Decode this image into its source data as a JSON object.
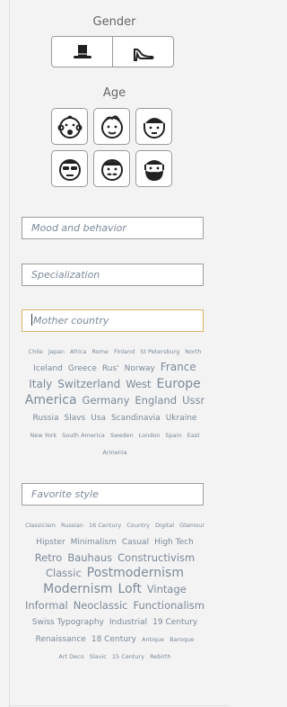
{
  "gender": {
    "label": "Gender",
    "options": [
      {
        "name": "male",
        "icon": "top-hat-icon"
      },
      {
        "name": "female",
        "icon": "high-heel-icon"
      }
    ]
  },
  "age": {
    "label": "Age",
    "options": [
      {
        "icon": "baby-face-icon"
      },
      {
        "icon": "child-face-icon"
      },
      {
        "icon": "teen-cap-face-icon"
      },
      {
        "icon": "sunglasses-face-icon"
      },
      {
        "icon": "mustache-face-icon"
      },
      {
        "icon": "bearded-face-icon"
      }
    ]
  },
  "mood": {
    "placeholder": "Mood and behavior"
  },
  "specialization": {
    "placeholder": "Specialization"
  },
  "mother_country": {
    "placeholder": "Mother country",
    "tags": [
      {
        "text": "Chile",
        "size": 6.5
      },
      {
        "text": "Japan",
        "size": 6.5
      },
      {
        "text": "Africa",
        "size": 6.5
      },
      {
        "text": "Rome",
        "size": 6.5
      },
      {
        "text": "Finland",
        "size": 6.5
      },
      {
        "text": "St Petersburg",
        "size": 6.5
      },
      {
        "text": "North",
        "size": 6.5
      },
      {
        "text": "Iceland",
        "size": 9
      },
      {
        "text": "Greece",
        "size": 9
      },
      {
        "text": "Rus'",
        "size": 9
      },
      {
        "text": "Norway",
        "size": 9
      },
      {
        "text": "France",
        "size": 12
      },
      {
        "text": "Italy",
        "size": 12
      },
      {
        "text": "Switzerland",
        "size": 12
      },
      {
        "text": "West",
        "size": 11.5
      },
      {
        "text": "Europe",
        "size": 14
      },
      {
        "text": "America",
        "size": 14
      },
      {
        "text": "Germany",
        "size": 11.5
      },
      {
        "text": "England",
        "size": 11.5
      },
      {
        "text": "Ussr",
        "size": 11.5
      },
      {
        "text": "Russia",
        "size": 9
      },
      {
        "text": "Slavs",
        "size": 9
      },
      {
        "text": "Usa",
        "size": 9
      },
      {
        "text": "Scandinavia",
        "size": 9
      },
      {
        "text": "Ukraine",
        "size": 9
      },
      {
        "text": "New York",
        "size": 6.5
      },
      {
        "text": "South America",
        "size": 6.5
      },
      {
        "text": "Sweden",
        "size": 6.5
      },
      {
        "text": "London",
        "size": 6.5
      },
      {
        "text": "Spain",
        "size": 6.5
      },
      {
        "text": "East",
        "size": 6.5
      },
      {
        "text": "Armenia",
        "size": 6.5
      }
    ]
  },
  "favorite_style": {
    "placeholder": "Favorite style",
    "tags": [
      {
        "text": "Classicism",
        "size": 6.5
      },
      {
        "text": "Russian",
        "size": 6.5
      },
      {
        "text": "16 Century",
        "size": 6.5
      },
      {
        "text": "Country",
        "size": 6.5
      },
      {
        "text": "Digital",
        "size": 6.5
      },
      {
        "text": "Glamour",
        "size": 6.5
      },
      {
        "text": "Hipster",
        "size": 9
      },
      {
        "text": "Minimalism",
        "size": 9
      },
      {
        "text": "Casual",
        "size": 9
      },
      {
        "text": "High Tech",
        "size": 9
      },
      {
        "text": "Retro",
        "size": 11.5
      },
      {
        "text": "Bauhaus",
        "size": 11.5
      },
      {
        "text": "Constructivism",
        "size": 11.5
      },
      {
        "text": "Classic",
        "size": 11.5
      },
      {
        "text": "Postmodernism",
        "size": 14
      },
      {
        "text": "Modernism",
        "size": 14
      },
      {
        "text": "Loft",
        "size": 14
      },
      {
        "text": "Vintage",
        "size": 11.5
      },
      {
        "text": "Informal",
        "size": 11.5
      },
      {
        "text": "Neoclassic",
        "size": 11.5
      },
      {
        "text": "Functionalism",
        "size": 11.5
      },
      {
        "text": "Swiss Typography",
        "size": 9
      },
      {
        "text": "Industrial",
        "size": 9
      },
      {
        "text": "19 Century",
        "size": 9
      },
      {
        "text": "Renaissance",
        "size": 9
      },
      {
        "text": "18 Century",
        "size": 9
      },
      {
        "text": "Antique",
        "size": 6.5
      },
      {
        "text": "Baroque",
        "size": 6.5
      },
      {
        "text": "Art Deco",
        "size": 6.5
      },
      {
        "text": "Slavic",
        "size": 6.5
      },
      {
        "text": "15 Century",
        "size": 6.5
      },
      {
        "text": "Rebirth",
        "size": 6.5
      }
    ]
  }
}
